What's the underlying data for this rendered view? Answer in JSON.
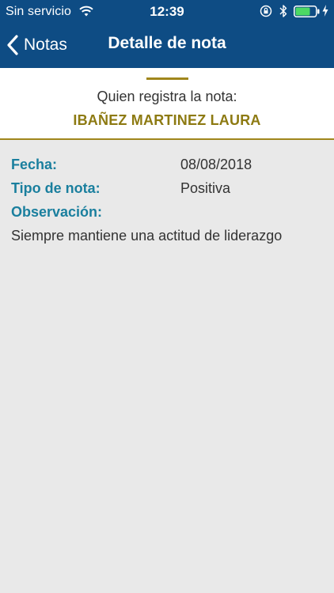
{
  "status_bar": {
    "carrier": "Sin servicio",
    "time": "12:39",
    "icons": [
      "wifi-icon",
      "orientation-lock-icon",
      "bluetooth-icon",
      "battery-icon",
      "charging-icon"
    ],
    "battery_color": "#4cd964"
  },
  "nav": {
    "back_label": "Notas",
    "title": "Detalle de nota"
  },
  "author": {
    "caption": "Quien registra la nota:",
    "name": "IBAÑEZ MARTINEZ LAURA"
  },
  "details": {
    "date_label": "Fecha:",
    "date_value": "08/08/2018",
    "type_label": "Tipo de nota:",
    "type_value": "Positiva",
    "observation_label": "Observación:",
    "observation_text": "Siempre mantiene una actitud de liderazgo"
  },
  "colors": {
    "nav_background": "#0e4c84",
    "accent_gold": "#a0861c",
    "label_teal": "#1a7f9e",
    "page_background": "#e9e9e9"
  }
}
